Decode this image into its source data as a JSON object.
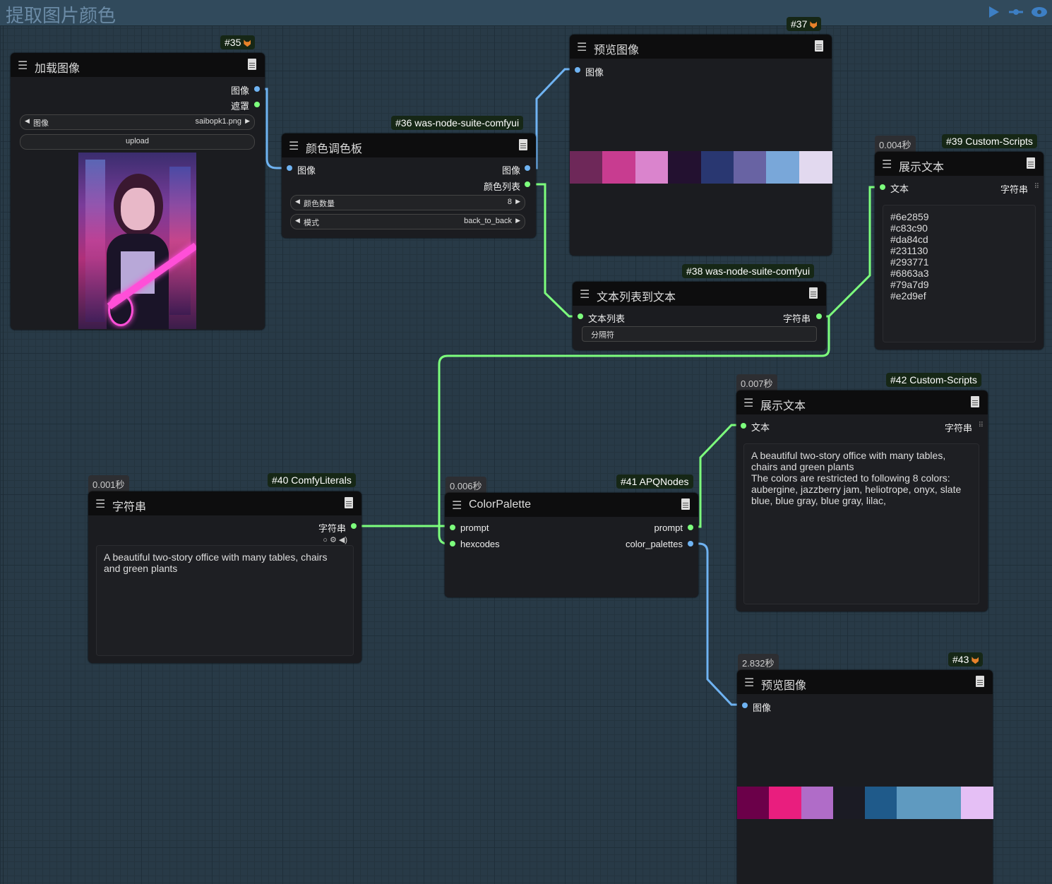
{
  "canvas": {
    "group_title": "提取图片颜色"
  },
  "nodes": {
    "n35": {
      "badge": "#35",
      "title": "加载图像",
      "outputs": [
        "图像",
        "遮罩"
      ],
      "widget_image": {
        "label": "图像",
        "value": "saibopk1.png"
      },
      "upload_label": "upload",
      "image_desc": "anime girl with headphones and pink neon guitar"
    },
    "n36": {
      "badge": "#36 was-node-suite-comfyui",
      "title": "颜色调色板",
      "input": "图像",
      "outputs": [
        "图像",
        "颜色列表"
      ],
      "widget_count": {
        "label": "颜色数量",
        "value": "8"
      },
      "widget_mode": {
        "label": "模式",
        "value": "back_to_back"
      }
    },
    "n37": {
      "badge": "#37",
      "title": "预览图像",
      "input": "图像",
      "swatches": [
        "#6e2859",
        "#c83c90",
        "#da84cd",
        "#231130",
        "#293771",
        "#6863a3",
        "#79a7d9",
        "#e2d9ef"
      ]
    },
    "n38": {
      "badge": "#38 was-node-suite-comfyui",
      "title": "文本列表到文本",
      "input": "文本列表",
      "output": "字符串",
      "widget_label": "分隔符"
    },
    "n39": {
      "badge": "#39 Custom-Scripts",
      "timing": "0.004秒",
      "title": "展示文本",
      "input": "文本",
      "output": "字符串",
      "text": "#6e2859\n#c83c90\n#da84cd\n#231130\n#293771\n#6863a3\n#79a7d9\n#e2d9ef"
    },
    "n40": {
      "badge": "#40 ComfyLiterals",
      "timing": "0.001秒",
      "title": "字符串",
      "output": "字符串",
      "text": "A beautiful two-story office with many tables, chairs and green plants"
    },
    "n41": {
      "badge": "#41 APQNodes",
      "timing": "0.006秒",
      "title": "ColorPalette",
      "inputs": [
        "prompt",
        "hexcodes"
      ],
      "outputs": [
        "prompt",
        "color_palettes"
      ]
    },
    "n42": {
      "badge": "#42 Custom-Scripts",
      "timing": "0.007秒",
      "title": "展示文本",
      "input": "文本",
      "output": "字符串",
      "text": "A beautiful two-story office with many tables, chairs and green plants\nThe colors are restricted to following 8 colors: aubergine, jazzberry jam, heliotrope, onyx, slate blue, blue gray, blue gray, lilac,"
    },
    "n43": {
      "badge": "#43",
      "timing": "2.832秒",
      "title": "预览图像",
      "input": "图像",
      "swatches": [
        "#6b0049",
        "#e91e7e",
        "#b06cc8",
        "#1b1b24",
        "#1f5a8a",
        "#5f9ac0",
        "#5f9ac0",
        "#e5bff5"
      ]
    }
  }
}
